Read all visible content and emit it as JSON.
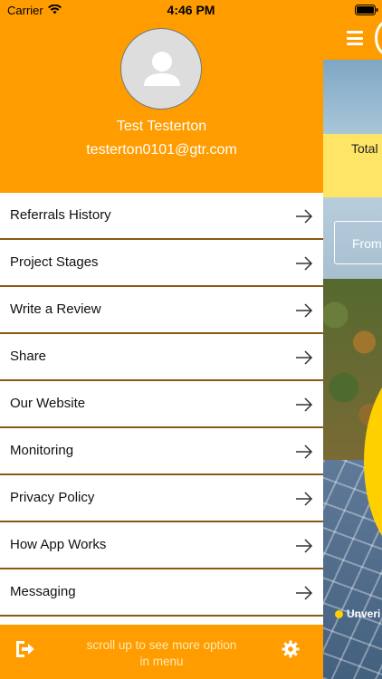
{
  "status_bar": {
    "carrier": "Carrier",
    "time": "4:46 PM",
    "wifi_icon": "wifi-icon",
    "battery_icon": "battery-icon"
  },
  "colors": {
    "brand_orange": "#ff9d00",
    "divider": "#8a5a14",
    "highlight_yellow": "#ffe566"
  },
  "profile": {
    "name": "Test Testerton",
    "email": "testerton0101@gtr.com",
    "avatar_icon": "person-icon"
  },
  "menu": {
    "items": [
      {
        "label": "Referrals History"
      },
      {
        "label": "Project Stages"
      },
      {
        "label": "Write a Review"
      },
      {
        "label": "Share"
      },
      {
        "label": "Our Website"
      },
      {
        "label": "Monitoring"
      },
      {
        "label": "Privacy Policy"
      },
      {
        "label": "How App Works"
      },
      {
        "label": "Messaging"
      }
    ],
    "item_icon": "arrow-right-icon"
  },
  "footer": {
    "logout_icon": "logout-icon",
    "hint": "scroll up to see more option in menu",
    "settings_icon": "gear-icon"
  },
  "background": {
    "menu_icon": "hamburger-menu-icon",
    "total_label": "Total",
    "from_label": "From",
    "status_label": "Unveri"
  }
}
